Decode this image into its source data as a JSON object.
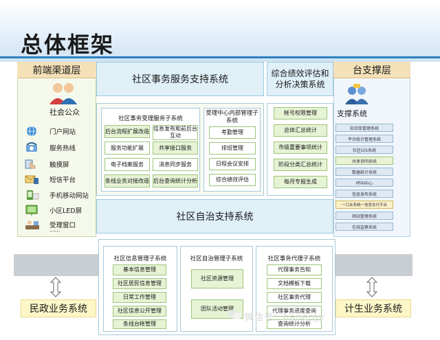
{
  "title": "总体框架",
  "front": {
    "header": "前端渠道层",
    "public_label": "社会公众",
    "channels": [
      "门户网站",
      "服务热线",
      "触摸屏",
      "短信平台",
      "手机移动网站",
      "小区LED屏",
      "受理窗口",
      "......"
    ]
  },
  "service": {
    "header": "社区事务服务支持系统",
    "acceptance": {
      "title": "社区事务受理服务子系统",
      "left_items": [
        "后台流程扩展改造",
        "服务功能扩展",
        "电子档案服务",
        "条线业务对接改造"
      ],
      "right_items": [
        "信息发布和前后台互动",
        "共享接口服务",
        "消息同步服务",
        "后台查询统计分析"
      ]
    },
    "internal": {
      "title": "受理中心内部管理子系统",
      "items": [
        "考勤管理",
        "排班管理",
        "日程会议安排",
        "综合绩效评估"
      ]
    }
  },
  "evaluation": {
    "header": "综合绩效评估和分析决策系统",
    "items": [
      "帐号权限管理",
      "总体汇总统计",
      "市级重要事项统计",
      "阶段分类汇总统计",
      "每月专报生成"
    ]
  },
  "support": {
    "header": "台支撑层",
    "label": "支撑系统",
    "items": [
      "知识库管理系统",
      "平台统计管理系统",
      "社区GIS系统",
      "共享协同系统",
      "数据统计系统",
      "呼叫中心",
      "信息发布系统",
      "一口业务统一信息支付平台",
      "网站管理系统",
      "在线监察系统"
    ]
  },
  "autonomy": {
    "header": "社区自治支持系统",
    "info_mgmt": {
      "title": "社区信息管理子系统",
      "items": [
        "基本信息管理",
        "社区居民信息管理",
        "日常工作管理",
        "社区信息公开管理",
        "条线台帐管理"
      ]
    },
    "self_mgmt": {
      "title": "社区自治管理子系统",
      "items": [
        "社区资源管理",
        "团队活动管理"
      ]
    },
    "agency": {
      "title": "社区事务代理子系统",
      "items": [
        "代理事务告知",
        "文档模板下载",
        "社区事务代理",
        "代理事务进度查询",
        "查询统计分析"
      ]
    }
  },
  "bottom": {
    "left": "民政业务系统",
    "right": "计生业务系统"
  },
  "watermark": "微信号：hanergy"
}
